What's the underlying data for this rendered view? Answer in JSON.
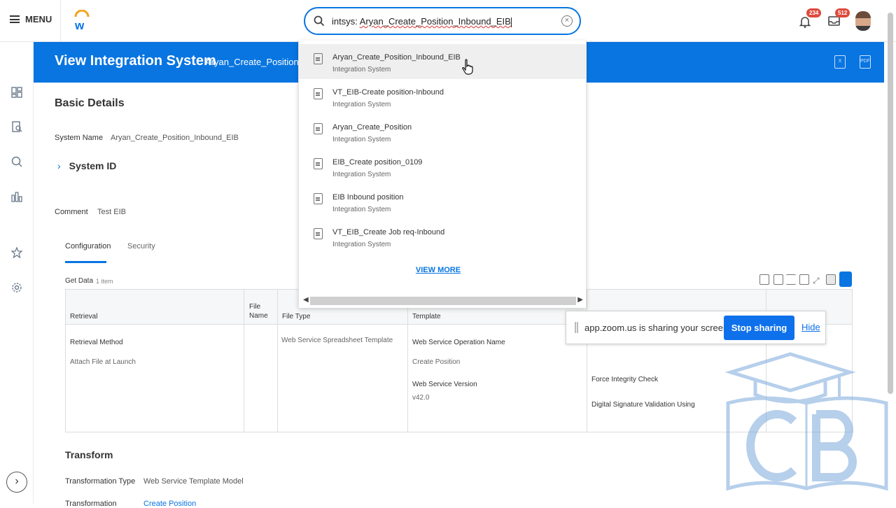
{
  "topbar": {
    "menu_label": "MENU",
    "search_prefix": "intsys: ",
    "search_query": "Aryan_Create_Position_Inbound_EIB",
    "notifications_count": "234",
    "inbox_count": "512"
  },
  "page": {
    "title": "View Integration System",
    "subtitle": "Aryan_Create_Position_In"
  },
  "basic_details": {
    "heading": "Basic Details",
    "system_name_label": "System Name",
    "system_name_value": "Aryan_Create_Position_Inbound_EIB",
    "system_id_label": "System ID",
    "comment_label": "Comment",
    "comment_value": "Test EIB"
  },
  "tabs": [
    {
      "label": "Configuration",
      "active": true
    },
    {
      "label": "Security",
      "active": false
    }
  ],
  "get_data": {
    "label": "Get Data",
    "count": "1 item"
  },
  "table": {
    "headers": [
      "Retrieval",
      "File Name",
      "File Type",
      "Template"
    ],
    "retrieval_method_label": "Retrieval Method",
    "retrieval_method_value": "Attach File at Launch",
    "file_type_value": "Web Service Spreadsheet Template",
    "ws_operation_label": "Web Service Operation Name",
    "ws_operation_value": "Create Position",
    "ws_version_label": "Web Service Version",
    "ws_version_value": "v42.0",
    "force_integrity": "Force Integrity Check",
    "digital_signature": "Digital Signature Validation Using"
  },
  "transform": {
    "heading": "Transform",
    "type_label": "Transformation Type",
    "type_value": "Web Service Template Model",
    "next_label": "Transformation",
    "next_value": "Create Position"
  },
  "search_results": {
    "items": [
      {
        "title": "Aryan_Create_Position_Inbound_EIB",
        "subtitle": "Integration System"
      },
      {
        "title": "VT_EIB-Create position-Inbound",
        "subtitle": "Integration System"
      },
      {
        "title": "Aryan_Create_Position",
        "subtitle": "Integration System"
      },
      {
        "title": "EIB_Create position_0109",
        "subtitle": "Integration System"
      },
      {
        "title": "EIB Inbound position",
        "subtitle": "Integration System"
      },
      {
        "title": "VT_EIB_Create Job req-Inbound",
        "subtitle": "Integration System"
      }
    ],
    "view_more": "VIEW MORE"
  },
  "zoom_share": {
    "message": "app.zoom.us is sharing your screen.",
    "stop_label": "Stop sharing",
    "hide_label": "Hide"
  },
  "colors": {
    "brand_blue": "#0875e1",
    "zoom_blue": "#0e71eb",
    "badge_red": "#de4a3c"
  }
}
